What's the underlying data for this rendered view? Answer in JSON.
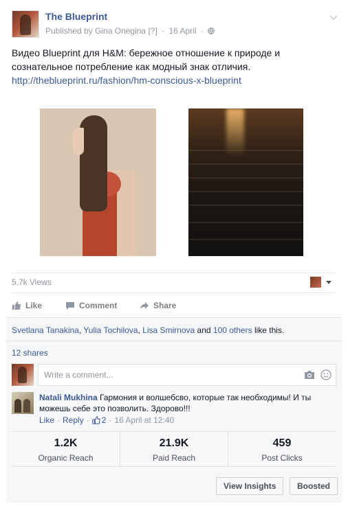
{
  "post": {
    "page_name": "The Blueprint",
    "published_by": "Published by Gina Onegina",
    "published_marker": "[?]",
    "date": "16 April",
    "separator": "·",
    "text": "Видео Blueprint для H&M: бережное отношение к природе и сознательное потребление как модный знак отличия.",
    "link": "http://theblueprint.ru/fashion/hm-conscious-x-blueprint",
    "views": "5.7k Views"
  },
  "actions": {
    "like": "Like",
    "comment": "Comment",
    "share": "Share"
  },
  "feedback": {
    "likers": [
      "Svetlana Tanakina",
      "Yulia Tochilova",
      "Lisa Smirnova"
    ],
    "likers_sep": ", ",
    "and_text": " and ",
    "others": "100 others",
    "like_suffix": " like this.",
    "shares": "12 shares",
    "comment_placeholder": "Write a comment..."
  },
  "comment": {
    "author": "Natali Mukhina",
    "text": "Гармония и волшебсво, которые так необходимы! И ты можешь себе это позволить. Здорово!!!",
    "like": "Like",
    "reply": "Reply",
    "likes": "2",
    "time": "16 April at 12:40"
  },
  "stats": [
    {
      "value": "1.2K",
      "label": "Organic Reach"
    },
    {
      "value": "21.9K",
      "label": "Paid Reach"
    },
    {
      "value": "459",
      "label": "Post Clicks"
    }
  ],
  "buttons": {
    "view_insights": "View Insights",
    "boosted": "Boosted"
  },
  "colors": {
    "link": "#3b5998",
    "muted": "#9197a3",
    "feedback_bg": "#f6f7f9"
  },
  "icons": [
    "chevron-down-icon",
    "globe-icon",
    "like-icon",
    "comment-icon",
    "share-icon",
    "camera-icon",
    "smiley-icon",
    "thumbs-up-icon"
  ]
}
